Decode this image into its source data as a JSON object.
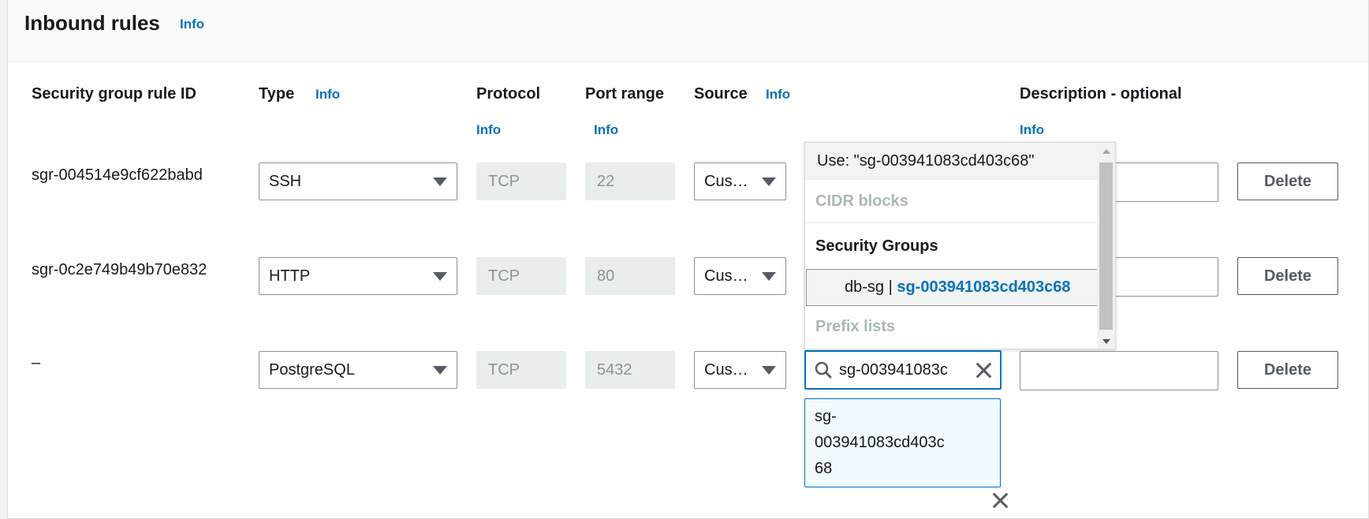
{
  "section": {
    "title": "Inbound rules",
    "info": "Info"
  },
  "columns": {
    "rule_id": "Security group rule ID",
    "type": "Type",
    "type_info": "Info",
    "protocol": "Protocol",
    "protocol_info": "Info",
    "port_range": "Port range",
    "port_info": "Info",
    "source": "Source",
    "source_info": "Info",
    "description": "Description - optional",
    "description_info": "Info"
  },
  "rules": [
    {
      "id": "sgr-004514e9cf622babd",
      "type": "SSH",
      "protocol": "TCP",
      "port": "22",
      "source_type": "Cus…",
      "delete": "Delete"
    },
    {
      "id": "sgr-0c2e749b49b70e832",
      "type": "HTTP",
      "protocol": "TCP",
      "port": "80",
      "source_type": "Cus…",
      "delete": "Delete"
    },
    {
      "id": "–",
      "type": "PostgreSQL",
      "protocol": "TCP",
      "port": "5432",
      "source_type": "Cus…",
      "delete": "Delete"
    }
  ],
  "source_search": {
    "query": "sg-003941083c"
  },
  "source_token": {
    "line1": "sg-",
    "line2": "003941083cd403c",
    "line3": "68"
  },
  "dropdown": {
    "use_option": "Use: \"sg-003941083cd403c68\"",
    "cidr_label": "CIDR blocks",
    "sg_label": "Security Groups",
    "sg_option_name": "db-sg",
    "sg_option_sep": " | ",
    "sg_option_id": "sg-003941083cd403c68",
    "prefix_label": "Prefix lists"
  },
  "colors": {
    "link": "#0073bb",
    "focus": "#0073bb",
    "readonly_bg": "#eaeded"
  }
}
